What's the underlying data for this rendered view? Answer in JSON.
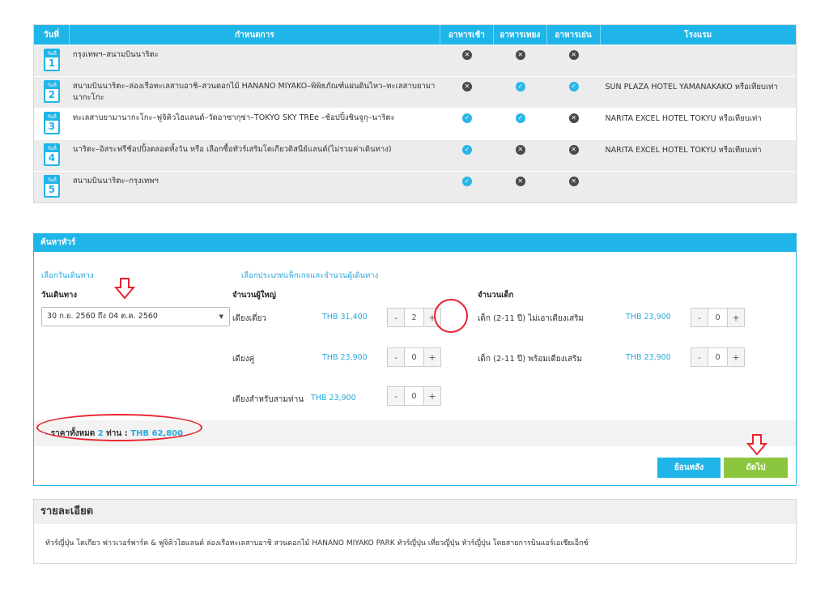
{
  "itinerary": {
    "headers": {
      "day": "วันที่",
      "program": "กำหนดการ",
      "breakfast": "อาหารเช้า",
      "lunch": "อาหารเทยง",
      "dinner": "อาหารเย่น",
      "hotel": "โรงแรม"
    },
    "day_tag": "วันที่",
    "rows": [
      {
        "day": "1",
        "program": "กรุงเทพฯ–สนามบินนาริตะ",
        "breakfast": "no",
        "lunch": "no",
        "dinner": "no",
        "hotel": ""
      },
      {
        "day": "2",
        "program": "สนามบินนาริตะ–ล่องเรือทะเลสาบอาชิ–สวนดอกไม้ HANANO MIYAKO–พิพิธภัณฑ์แผ่นดินไหว–ทะเลสาบยามานากะโกะ",
        "breakfast": "no",
        "lunch": "yes",
        "dinner": "yes",
        "hotel": "SUN PLAZA HOTEL YAMANAKAKO หรือเทียบเท่า"
      },
      {
        "day": "3",
        "program": "ทะเลสาบยามานากะโกะ–ฟูจิคิวไฮแลนด์–วัดอาซากุซ่า–TOKYO SKY TREe –ช้อปปิ้งชินจูกุ–นาริตะ",
        "breakfast": "yes",
        "lunch": "yes",
        "dinner": "no",
        "hotel": "NARITA EXCEL HOTEL TOKYU หรือเทียบเท่า"
      },
      {
        "day": "4",
        "program": "นาริตะ–อิสระฟรีช้อปปิ้งตลอดทั้งวัน หรือ เลือกซื้อทัวร์เสริมโตเกียวดิสนีย์แลนด์(ไม่รวมค่าเดินทาง)",
        "breakfast": "yes",
        "lunch": "no",
        "dinner": "no",
        "hotel": "NARITA EXCEL HOTEL TOKYU หรือเทียบเท่า"
      },
      {
        "day": "5",
        "program": "สนามบินนาริตะ–กรุงเทพฯ",
        "breakfast": "yes",
        "lunch": "no",
        "dinner": "no",
        "hotel": ""
      }
    ]
  },
  "search": {
    "title": "ค้นหาทัวร์",
    "choose_date_link": "เลือกวันเดินทาง",
    "choose_type_link": "เลือกประเภทแพ็กเกจและจำนวนผู้เดินทาง",
    "date_label": "วันเดินทาง",
    "date_value": "30 ก.ย. 2560 ถึง 04 ต.ค. 2560",
    "adults_label": "จำนวนผู้ใหญ่",
    "children_label": "จำนวนเด็ก",
    "adult_rows": [
      {
        "label": "เดียงเดี่ยว",
        "price": "THB 31,400",
        "qty": "2"
      },
      {
        "label": "เดียงคู่",
        "price": "THB 23,900",
        "qty": "0"
      },
      {
        "label": "เดียงสำหรับสามท่าน",
        "price": "THB 23,900",
        "qty": "0"
      }
    ],
    "child_rows": [
      {
        "label": "เด็ก (2-11 ปี) ไม่เอาเดียงเสริม",
        "price": "THB 23,900",
        "qty": "0"
      },
      {
        "label": "เด็ก (2-11 ปี) พร้อมเดียงเสริม",
        "price": "THB 23,900",
        "qty": "0"
      }
    ],
    "minus": "-",
    "plus": "+",
    "total_prefix": "ราคาทั้งหมด",
    "total_count": "2",
    "total_mid": "ท่าน :",
    "total_price": "THB 62,800",
    "back_button": "ย้อนหลัง",
    "next_button": "ถัดไป"
  },
  "details": {
    "title": "รายละเอียด",
    "text": "ทัวร์ญี่ปุ่น โตเกียว ฟาวเวอร์พาร์ค & ฟูจิคิวไฮแลนด์ ล่องเรือทะเลสาบอาชิ สวนดอกไม้ HANANO MIYAKO PARK ทัวร์ญี่ปุ่น เที่ยวญี่ปุ่น ทัวร์ญี่ปุ่น โดยสายการบินแอร์เอเชียเอ็กซ์"
  },
  "colors": {
    "accent": "#1fb5e8",
    "next": "#8cc63f",
    "annotation": "#e8232d"
  },
  "icons": {
    "yes": "check-circle-icon",
    "no": "x-circle-icon",
    "day": "calendar-icon"
  }
}
